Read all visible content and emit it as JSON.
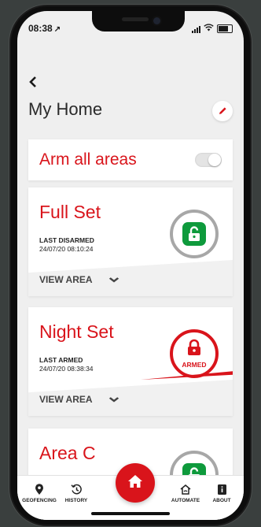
{
  "status_bar": {
    "time": "08:38",
    "location_arrow": "↗"
  },
  "header": {
    "back_icon": "chevron-left-icon",
    "title": "My Home",
    "edit_icon": "pencil-icon"
  },
  "arm_all": {
    "label": "Arm all areas",
    "enabled": false
  },
  "areas": [
    {
      "name": "Full Set",
      "state_label": "LAST DISARMED",
      "state_date": "24/07/20 08:10:24",
      "view_label": "VIEW AREA",
      "status": "disarmed"
    },
    {
      "name": "Night Set",
      "state_label": "LAST ARMED",
      "state_date": "24/07/20 08:38:34",
      "view_label": "VIEW AREA",
      "status": "armed",
      "badge": "ARMED"
    },
    {
      "name": "Area C",
      "status": "disarmed"
    }
  ],
  "tabbar": {
    "items": [
      {
        "label": "GEOFENCING",
        "icon": "location-pin-icon"
      },
      {
        "label": "HISTORY",
        "icon": "history-icon"
      },
      {
        "label": "",
        "icon": "home-icon"
      },
      {
        "label": "AUTOMATE",
        "icon": "automate-icon"
      },
      {
        "label": "ABOUT",
        "icon": "info-icon"
      }
    ]
  },
  "colors": {
    "accent": "#d9141b",
    "disarmed": "#0e9a3c",
    "ring": "#a7a7a7",
    "background": "#efefef"
  }
}
